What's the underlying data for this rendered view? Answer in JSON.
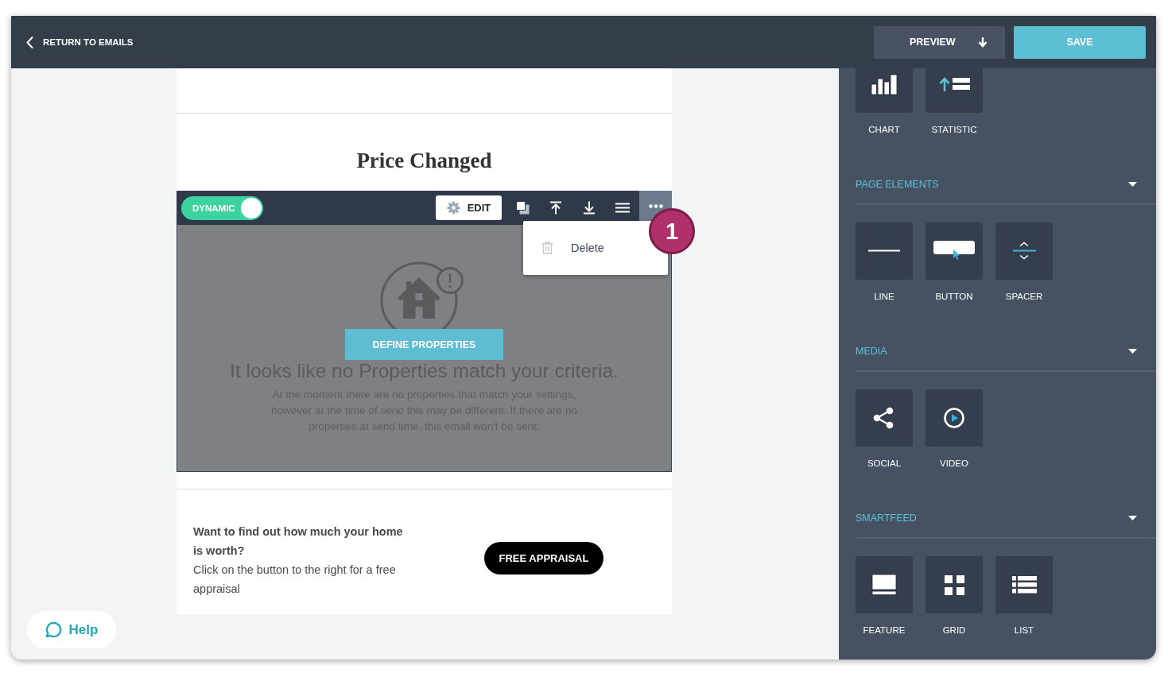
{
  "header": {
    "back_link": "RETURN TO EMAILS",
    "preview_button": "PREVIEW",
    "save_button": "SAVE"
  },
  "email": {
    "heading": "Price Changed",
    "block_toolbar": {
      "dynamic_toggle": {
        "label": "DYNAMIC",
        "on": true
      },
      "edit_button": "EDIT",
      "more_menu": {
        "open": true,
        "items": [
          {
            "label": "Delete"
          }
        ]
      }
    },
    "step_badge": "1",
    "empty_state": {
      "button": "DEFINE PROPERTIES",
      "title": "It looks like no Properties match your criteria.",
      "message": "At the moment there are no properties that match your settings, however at the time of send this may be different. If there are no properties at send time, this email won't be sent."
    },
    "cta": {
      "heading": "Want to find out how much your home is worth?",
      "text": "Click on the button to the right for a free appraisal",
      "button": "FREE APPRAISAL"
    }
  },
  "help_button": "Help",
  "sidebar": {
    "sections": [
      {
        "items": [
          {
            "label": "CHART",
            "kind": "chart"
          },
          {
            "label": "STATISTIC",
            "kind": "statistic"
          }
        ]
      },
      {
        "title": "PAGE ELEMENTS",
        "items": [
          {
            "label": "LINE",
            "kind": "line"
          },
          {
            "label": "BUTTON",
            "kind": "button"
          },
          {
            "label": "SPACER",
            "kind": "spacer"
          }
        ]
      },
      {
        "title": "MEDIA",
        "items": [
          {
            "label": "SOCIAL",
            "kind": "social"
          },
          {
            "label": "VIDEO",
            "kind": "video"
          }
        ]
      },
      {
        "title": "SMARTFEED",
        "items": [
          {
            "label": "FEATURE",
            "kind": "feature"
          },
          {
            "label": "GRID",
            "kind": "grid"
          },
          {
            "label": "LIST",
            "kind": "list"
          }
        ]
      }
    ]
  }
}
